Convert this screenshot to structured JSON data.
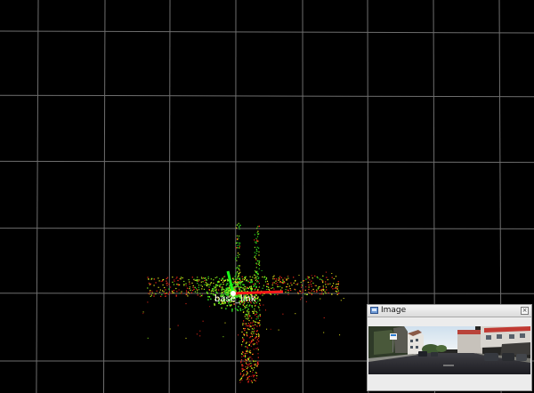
{
  "viewport": {
    "background_color": "#000000",
    "grid_color": "#6e6e6e",
    "point_colors": [
      "#2fdc1e",
      "#8ef01a",
      "#e8e81a",
      "#ff2a1a",
      "#b01010"
    ]
  },
  "frame_label": "base_link",
  "image_panel": {
    "title": "Image",
    "icon": "image-window-icon",
    "close_icon": "close-icon",
    "close_glyph": "×"
  }
}
